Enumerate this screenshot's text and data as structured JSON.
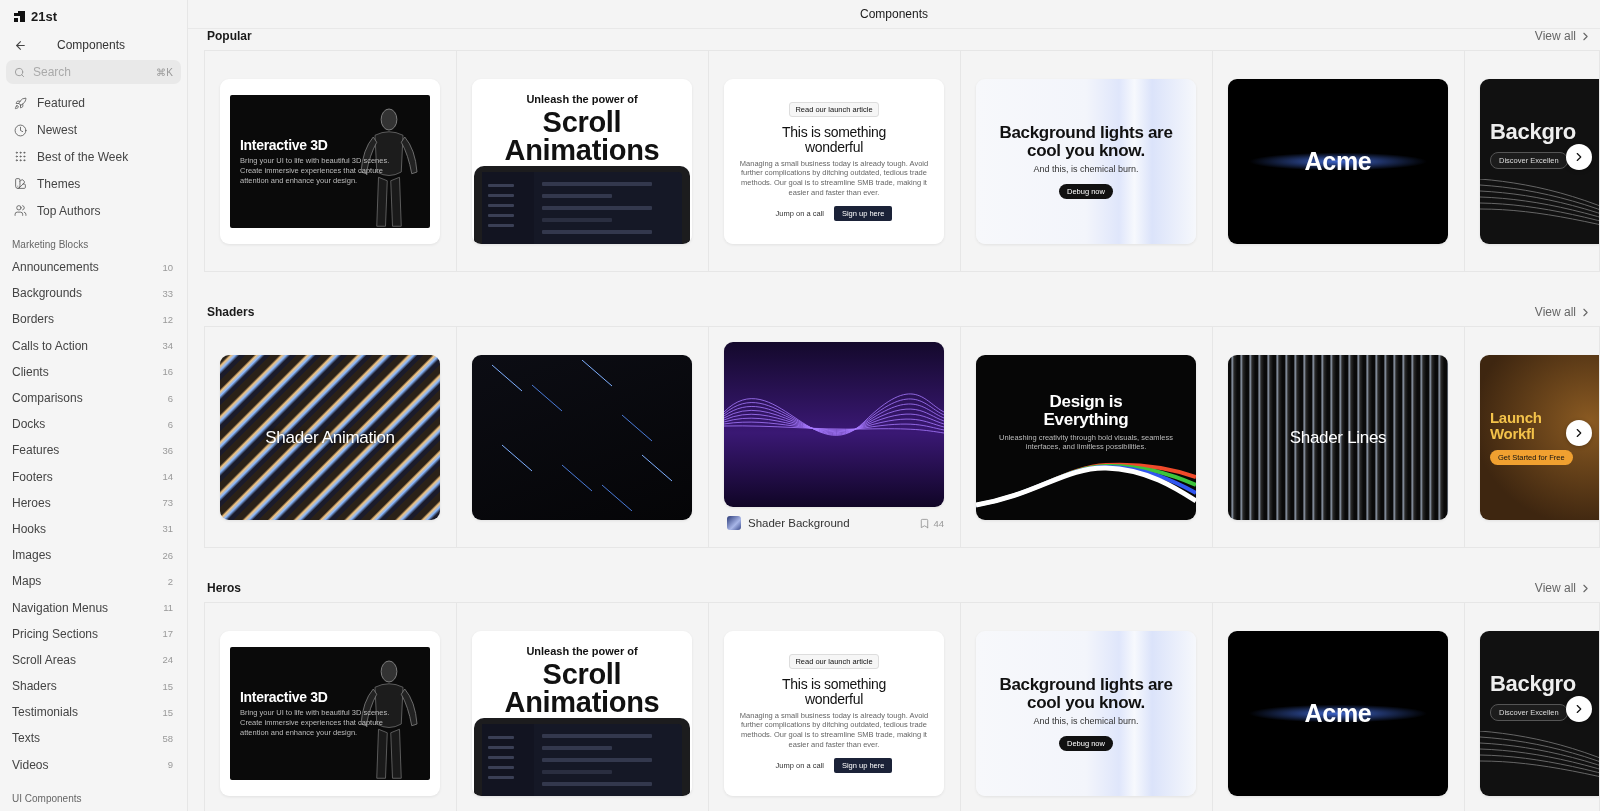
{
  "brand": {
    "name": "21st"
  },
  "sidebar": {
    "title": "Components",
    "search": {
      "placeholder": "Search",
      "shortcut": "⌘K"
    },
    "nav": [
      {
        "label": "Featured"
      },
      {
        "label": "Newest"
      },
      {
        "label": "Best of the Week"
      },
      {
        "label": "Themes"
      },
      {
        "label": "Top Authors"
      }
    ],
    "groups": [
      {
        "title": "Marketing Blocks",
        "items": [
          {
            "label": "Announcements",
            "count": "10"
          },
          {
            "label": "Backgrounds",
            "count": "33"
          },
          {
            "label": "Borders",
            "count": "12"
          },
          {
            "label": "Calls to Action",
            "count": "34"
          },
          {
            "label": "Clients",
            "count": "16"
          },
          {
            "label": "Comparisons",
            "count": "6"
          },
          {
            "label": "Docks",
            "count": "6"
          },
          {
            "label": "Features",
            "count": "36"
          },
          {
            "label": "Footers",
            "count": "14"
          },
          {
            "label": "Heroes",
            "count": "73"
          },
          {
            "label": "Hooks",
            "count": "31"
          },
          {
            "label": "Images",
            "count": "26"
          },
          {
            "label": "Maps",
            "count": "2"
          },
          {
            "label": "Navigation Menus",
            "count": "11"
          },
          {
            "label": "Pricing Sections",
            "count": "17"
          },
          {
            "label": "Scroll Areas",
            "count": "24"
          },
          {
            "label": "Shaders",
            "count": "15"
          },
          {
            "label": "Testimonials",
            "count": "15"
          },
          {
            "label": "Texts",
            "count": "58"
          },
          {
            "label": "Videos",
            "count": "9"
          }
        ]
      },
      {
        "title": "UI Components"
      }
    ]
  },
  "header": {
    "title": "Components"
  },
  "sections": [
    {
      "title": "Popular",
      "view_all": "View all",
      "cards": [
        {
          "hovered": false,
          "preview": {
            "kind": "robot",
            "headline": [
              "Interactive 3D"
            ],
            "body": "Bring your UI to life with beautiful 3D scenes. Create immersive experiences that capture attention and enhance your design."
          }
        },
        {
          "hovered": false,
          "preview": {
            "kind": "scroll",
            "kicker": "Unleash the power of",
            "headline": [
              "Scroll",
              "Animations"
            ]
          }
        },
        {
          "hovered": false,
          "preview": {
            "kind": "launch",
            "badge": "Read our launch article",
            "headline": [
              "This is something",
              "wonderful"
            ],
            "body": "Managing a small business today is already tough. Avoid further complications by ditching outdated, tedious trade methods. Our goal is to streamline SMB trade, making it easier and faster than ever.",
            "buttons": [
              "Jump on a call",
              "Sign up here"
            ]
          }
        },
        {
          "hovered": false,
          "preview": {
            "kind": "lights",
            "headline": [
              "Background lights are",
              "cool you know."
            ],
            "body": "And this, is chemical burn.",
            "buttons": [
              "Debug now"
            ]
          }
        },
        {
          "hovered": false,
          "preview": {
            "kind": "acme",
            "headline": [
              "Acme"
            ]
          }
        },
        {
          "hovered": false,
          "preview": {
            "kind": "paths",
            "headline": [
              "Backgro"
            ],
            "buttons": [
              "Discover Excellen"
            ]
          }
        }
      ]
    },
    {
      "title": "Shaders",
      "view_all": "View all",
      "cards": [
        {
          "hovered": false,
          "preview": {
            "kind": "stripes",
            "headline": [
              "Shader Animation"
            ]
          }
        },
        {
          "hovered": false,
          "preview": {
            "kind": "streaks"
          }
        },
        {
          "hovered": true,
          "title": "Shader Background",
          "bookmarks": "44",
          "preview": {
            "kind": "waves"
          }
        },
        {
          "hovered": false,
          "preview": {
            "kind": "rainbow",
            "headline": [
              "Design is",
              "Everything"
            ],
            "body": "Unleashing creativity through bold visuals, seamless interfaces, and limitless possibilities."
          }
        },
        {
          "hovered": false,
          "preview": {
            "kind": "lines",
            "headline": [
              "Shader Lines"
            ]
          }
        },
        {
          "hovered": false,
          "preview": {
            "kind": "amber",
            "headline": [
              "Launch",
              "Workfl"
            ],
            "buttons": [
              "Get Started for Free"
            ]
          }
        }
      ]
    },
    {
      "title": "Heros",
      "view_all": "View all",
      "cards": [
        {
          "hovered": false,
          "preview": {
            "kind": "robot",
            "headline": [
              "Interactive 3D"
            ],
            "body": "Bring your UI to life with beautiful 3D scenes. Create immersive experiences that capture attention and enhance your design."
          }
        },
        {
          "hovered": false,
          "preview": {
            "kind": "scroll",
            "kicker": "Unleash the power of",
            "headline": [
              "Scroll",
              "Animations"
            ]
          }
        },
        {
          "hovered": false,
          "preview": {
            "kind": "launch",
            "badge": "Read our launch article",
            "headline": [
              "This is something",
              "wonderful"
            ],
            "body": "Managing a small business today is already tough. Avoid further complications by ditching outdated, tedious trade methods. Our goal is to streamline SMB trade, making it easier and faster than ever.",
            "buttons": [
              "Jump on a call",
              "Sign up here"
            ]
          }
        },
        {
          "hovered": false,
          "preview": {
            "kind": "lights",
            "headline": [
              "Background lights are",
              "cool you know."
            ],
            "body": "And this, is chemical burn.",
            "buttons": [
              "Debug now"
            ]
          }
        },
        {
          "hovered": false,
          "preview": {
            "kind": "acme",
            "headline": [
              "Acme"
            ]
          }
        },
        {
          "hovered": false,
          "preview": {
            "kind": "paths",
            "headline": [
              "Backgro"
            ],
            "buttons": [
              "Discover Excellen"
            ]
          }
        }
      ]
    }
  ]
}
